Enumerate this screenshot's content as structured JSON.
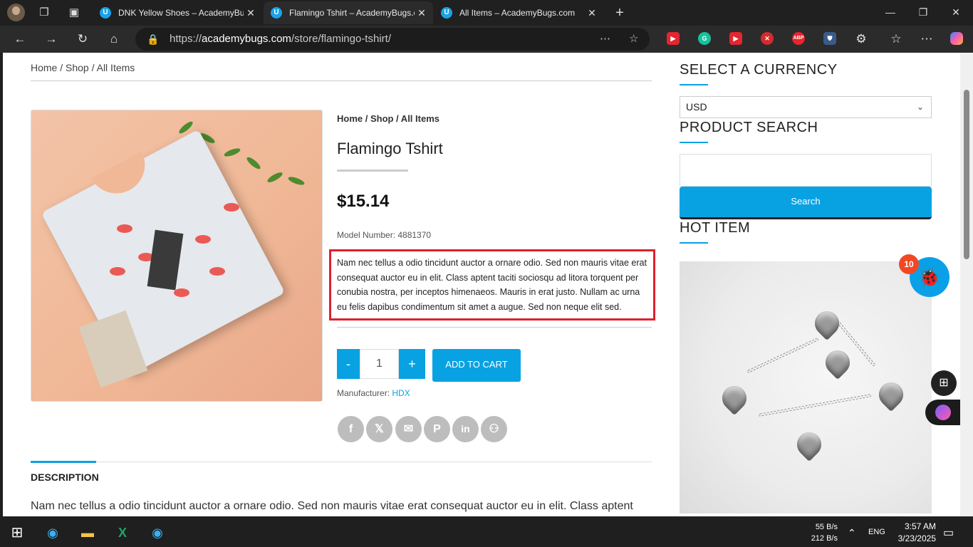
{
  "browser": {
    "tabs": [
      {
        "label": "DNK Yellow Shoes – AcademyBugs.com",
        "favicon": "U",
        "active": false
      },
      {
        "label": "Flamingo Tshirt – AcademyBugs.com",
        "favicon": "U",
        "active": true
      },
      {
        "label": "All Items – AcademyBugs.com",
        "favicon": "U",
        "active": false
      }
    ],
    "url_prefix": "https://",
    "url_host": "academybugs.com",
    "url_path": "/store/flamingo-tshirt/"
  },
  "breadcrumb_top": "Home / Shop / All Items",
  "product": {
    "breadcrumb": "Home / Shop / All Items",
    "title": "Flamingo Tshirt",
    "price": "$15.14",
    "model_number": "Model Number: 4881370",
    "short_description": "Nam nec tellus a odio tincidunt auctor a ornare odio. Sed non mauris vitae erat consequat auctor eu in elit. Class aptent taciti sociosqu ad litora torquent per conubia nostra, per inceptos himenaeos. Mauris in erat justo. Nullam ac urna eu felis dapibus condimentum sit amet a augue. Sed non neque elit sed.",
    "quantity": "1",
    "minus_label": "-",
    "plus_label": "+",
    "add_to_cart_label": "ADD TO CART",
    "manufacturer_label": "Manufacturer:",
    "manufacturer_value": "HDX",
    "share_icons": [
      "facebook-icon",
      "x-icon",
      "email-icon",
      "pinterest-icon",
      "linkedin-icon",
      "myspace-icon"
    ]
  },
  "description": {
    "tab_label": "DESCRIPTION",
    "text": "Nam nec tellus a odio tincidunt auctor a ornare odio. Sed non mauris vitae erat consequat auctor eu in elit. Class aptent"
  },
  "sidebar": {
    "currency_heading": "SELECT A CURRENCY",
    "currency_value": "USD",
    "search_heading": "PRODUCT SEARCH",
    "search_button": "Search",
    "hot_heading": "HOT ITEM"
  },
  "widget": {
    "bug_count": "10"
  },
  "taskbar": {
    "net_down": "55 B/s",
    "net_up": "212 B/s",
    "lang": "ENG",
    "time": "3:57 AM",
    "date": "3/23/2025"
  },
  "colors": {
    "accent": "#08a2e3",
    "highlight_border": "#e0202e",
    "badge": "#f24722"
  }
}
